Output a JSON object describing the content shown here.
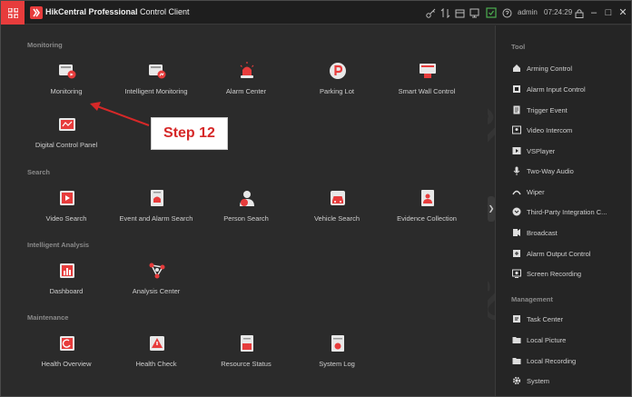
{
  "titlebar": {
    "app_name_bold": "HikCentral Professional",
    "app_name_rest": " Control Client",
    "user": "admin",
    "time": "07:24:29",
    "icons": [
      "key-icon",
      "transfer-icon",
      "archive-icon",
      "display-icon",
      "alarm-icon",
      "help-icon",
      "lock-icon"
    ],
    "minimize": "–",
    "restore": "□",
    "close": "✕"
  },
  "main": {
    "monitoring": {
      "title": "Monitoring",
      "tiles": [
        {
          "label": "Monitoring",
          "icon": "monitoring-icon"
        },
        {
          "label": "Intelligent Monitoring",
          "icon": "intelligent-monitoring-icon"
        },
        {
          "label": "Alarm Center",
          "icon": "alarm-center-icon"
        },
        {
          "label": "Parking Lot",
          "icon": "parking-lot-icon"
        },
        {
          "label": "Smart Wall Control",
          "icon": "smart-wall-icon"
        },
        {
          "label": "Digital Control Panel",
          "icon": "digital-control-panel-icon"
        }
      ]
    },
    "search": {
      "title": "Search",
      "tiles": [
        {
          "label": "Video Search",
          "icon": "video-search-icon"
        },
        {
          "label": "Event and Alarm Search",
          "icon": "event-alarm-search-icon"
        },
        {
          "label": "Person Search",
          "icon": "person-search-icon"
        },
        {
          "label": "Vehicle Search",
          "icon": "vehicle-search-icon"
        },
        {
          "label": "Evidence Collection",
          "icon": "evidence-collection-icon"
        }
      ]
    },
    "intelligent_analysis": {
      "title": "Intelligent Analysis",
      "tiles": [
        {
          "label": "Dashboard",
          "icon": "dashboard-icon"
        },
        {
          "label": "Analysis Center",
          "icon": "analysis-center-icon"
        }
      ]
    },
    "maintenance": {
      "title": "Maintenance",
      "tiles": [
        {
          "label": "Health Overview",
          "icon": "health-overview-icon"
        },
        {
          "label": "Health Check",
          "icon": "health-check-icon"
        },
        {
          "label": "Resource Status",
          "icon": "resource-status-icon"
        },
        {
          "label": "System Log",
          "icon": "system-log-icon"
        }
      ]
    }
  },
  "sidepanel": {
    "tool": {
      "title": "Tool",
      "items": [
        {
          "label": "Arming Control",
          "icon": "home-shield-icon"
        },
        {
          "label": "Alarm Input Control",
          "icon": "alarm-input-icon"
        },
        {
          "label": "Trigger Event",
          "icon": "trigger-event-icon"
        },
        {
          "label": "Video Intercom",
          "icon": "video-intercom-icon"
        },
        {
          "label": "VSPlayer",
          "icon": "vsplayer-icon"
        },
        {
          "label": "Two-Way Audio",
          "icon": "microphone-icon"
        },
        {
          "label": "Wiper",
          "icon": "wiper-icon"
        },
        {
          "label": "Third-Party Integration C...",
          "icon": "integration-icon"
        },
        {
          "label": "Broadcast",
          "icon": "broadcast-icon"
        },
        {
          "label": "Alarm Output Control",
          "icon": "alarm-output-icon"
        },
        {
          "label": "Screen Recording",
          "icon": "screen-recording-icon"
        }
      ]
    },
    "management": {
      "title": "Management",
      "items": [
        {
          "label": "Task Center",
          "icon": "task-center-icon"
        },
        {
          "label": "Local Picture",
          "icon": "local-picture-icon"
        },
        {
          "label": "Local Recording",
          "icon": "local-recording-icon"
        },
        {
          "label": "System",
          "icon": "gear-icon"
        }
      ]
    }
  },
  "annotation": {
    "callout": "Step 12",
    "arrow_color": "#d62828"
  },
  "colors": {
    "accent": "#e73c3c",
    "background": "#2b2b2b",
    "titlebar": "#1e1e1e",
    "sidepanel": "#252525",
    "text": "#cfcfcf",
    "section": "#8a8a8a"
  }
}
